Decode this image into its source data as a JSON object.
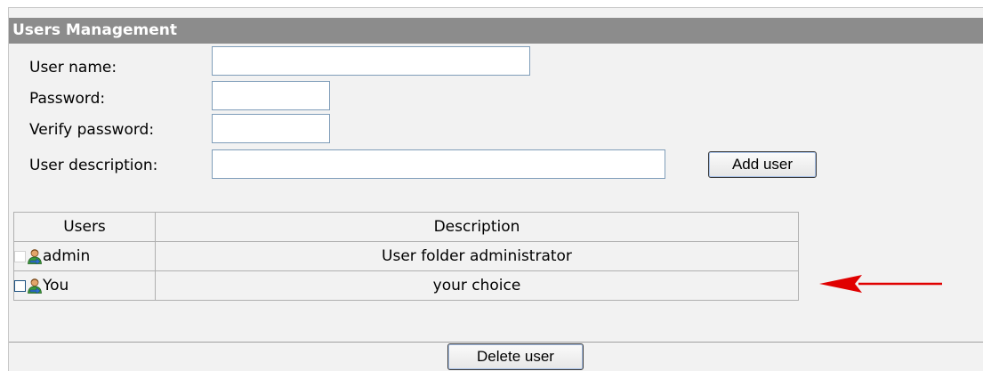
{
  "panel": {
    "title": "Users Management"
  },
  "form": {
    "username_label": "User name:",
    "username_value": "",
    "password_label": "Password:",
    "password_value": "",
    "verify_label": "Verify password:",
    "verify_value": "",
    "description_label": "User description:",
    "description_value": "",
    "add_button": "Add user"
  },
  "table": {
    "headers": [
      "Users",
      "Description"
    ],
    "rows": [
      {
        "user": "admin",
        "description": "User folder administrator",
        "checkbox_enabled": false
      },
      {
        "user": "You",
        "description": "your choice",
        "checkbox_enabled": true
      }
    ]
  },
  "actions": {
    "delete_button": "Delete user"
  },
  "annotation": {
    "arrow_color": "#e00000"
  },
  "colors": {
    "title_bar": "#8c8c8c",
    "panel_bg": "#f2f2f2"
  },
  "icons": {
    "user": "user-icon",
    "arrow": "arrow-left-icon"
  }
}
